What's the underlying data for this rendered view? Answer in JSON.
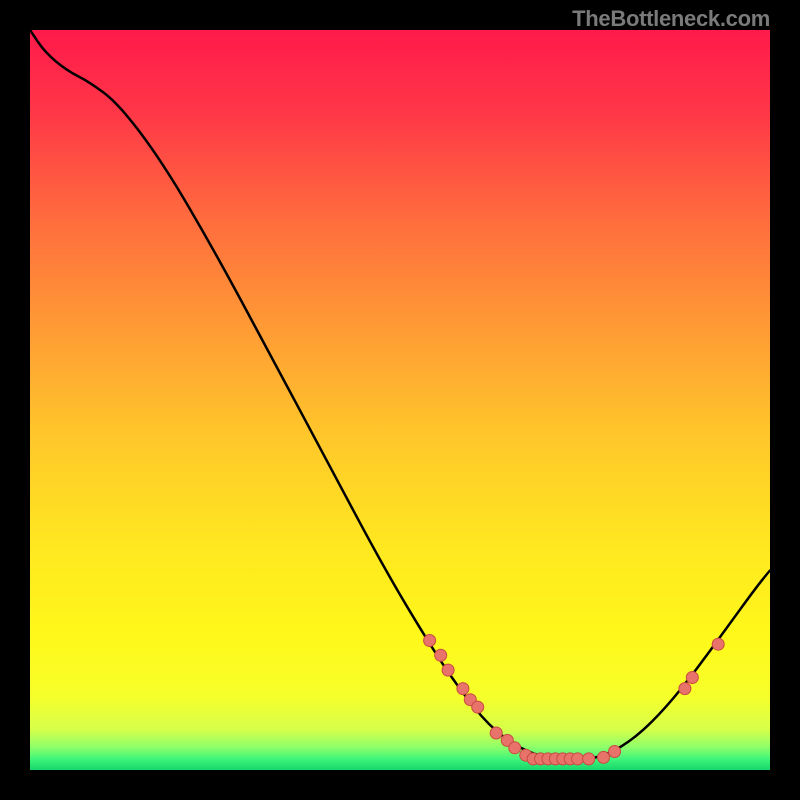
{
  "watermark": "TheBottleneck.com",
  "colors": {
    "bg": "#000000",
    "curve": "#000000",
    "marker_fill": "#e8736a",
    "marker_stroke": "#c94a41",
    "gradient_stops": [
      {
        "offset": 0.0,
        "color": "#ff1a4b"
      },
      {
        "offset": 0.1,
        "color": "#ff3348"
      },
      {
        "offset": 0.25,
        "color": "#ff6a3e"
      },
      {
        "offset": 0.4,
        "color": "#ff9a35"
      },
      {
        "offset": 0.55,
        "color": "#ffc72a"
      },
      {
        "offset": 0.7,
        "color": "#ffe820"
      },
      {
        "offset": 0.82,
        "color": "#fff81a"
      },
      {
        "offset": 0.9,
        "color": "#f6ff2a"
      },
      {
        "offset": 0.945,
        "color": "#d7ff4a"
      },
      {
        "offset": 0.97,
        "color": "#8aff6a"
      },
      {
        "offset": 0.985,
        "color": "#40f57a"
      },
      {
        "offset": 1.0,
        "color": "#16d66b"
      }
    ]
  },
  "chart_data": {
    "type": "line",
    "title": "",
    "xlabel": "",
    "ylabel": "",
    "xlim": [
      0,
      100
    ],
    "ylim": [
      0,
      100
    ],
    "curve": [
      {
        "x": 0.0,
        "y": 100.0
      },
      {
        "x": 2.0,
        "y": 97.0
      },
      {
        "x": 5.0,
        "y": 94.5
      },
      {
        "x": 8.0,
        "y": 93.0
      },
      {
        "x": 12.0,
        "y": 90.0
      },
      {
        "x": 18.0,
        "y": 82.0
      },
      {
        "x": 25.0,
        "y": 70.0
      },
      {
        "x": 32.0,
        "y": 57.0
      },
      {
        "x": 40.0,
        "y": 42.0
      },
      {
        "x": 48.0,
        "y": 27.0
      },
      {
        "x": 54.0,
        "y": 17.0
      },
      {
        "x": 58.0,
        "y": 11.0
      },
      {
        "x": 62.0,
        "y": 6.0
      },
      {
        "x": 66.0,
        "y": 3.0
      },
      {
        "x": 70.0,
        "y": 1.5
      },
      {
        "x": 74.0,
        "y": 1.2
      },
      {
        "x": 78.0,
        "y": 2.0
      },
      {
        "x": 82.0,
        "y": 4.5
      },
      {
        "x": 86.0,
        "y": 8.5
      },
      {
        "x": 90.0,
        "y": 13.5
      },
      {
        "x": 94.0,
        "y": 19.0
      },
      {
        "x": 98.0,
        "y": 24.5
      },
      {
        "x": 100.0,
        "y": 27.0
      }
    ],
    "markers": [
      {
        "x": 54.0,
        "y": 17.5
      },
      {
        "x": 55.5,
        "y": 15.5
      },
      {
        "x": 56.5,
        "y": 13.5
      },
      {
        "x": 58.5,
        "y": 11.0
      },
      {
        "x": 59.5,
        "y": 9.5
      },
      {
        "x": 60.5,
        "y": 8.5
      },
      {
        "x": 63.0,
        "y": 5.0
      },
      {
        "x": 64.5,
        "y": 4.0
      },
      {
        "x": 65.5,
        "y": 3.0
      },
      {
        "x": 67.0,
        "y": 2.0
      },
      {
        "x": 68.0,
        "y": 1.5
      },
      {
        "x": 69.0,
        "y": 1.5
      },
      {
        "x": 70.0,
        "y": 1.5
      },
      {
        "x": 71.0,
        "y": 1.5
      },
      {
        "x": 72.0,
        "y": 1.5
      },
      {
        "x": 73.0,
        "y": 1.5
      },
      {
        "x": 74.0,
        "y": 1.5
      },
      {
        "x": 75.5,
        "y": 1.5
      },
      {
        "x": 77.5,
        "y": 1.7
      },
      {
        "x": 79.0,
        "y": 2.5
      },
      {
        "x": 88.5,
        "y": 11.0
      },
      {
        "x": 89.5,
        "y": 12.5
      },
      {
        "x": 93.0,
        "y": 17.0
      }
    ]
  }
}
